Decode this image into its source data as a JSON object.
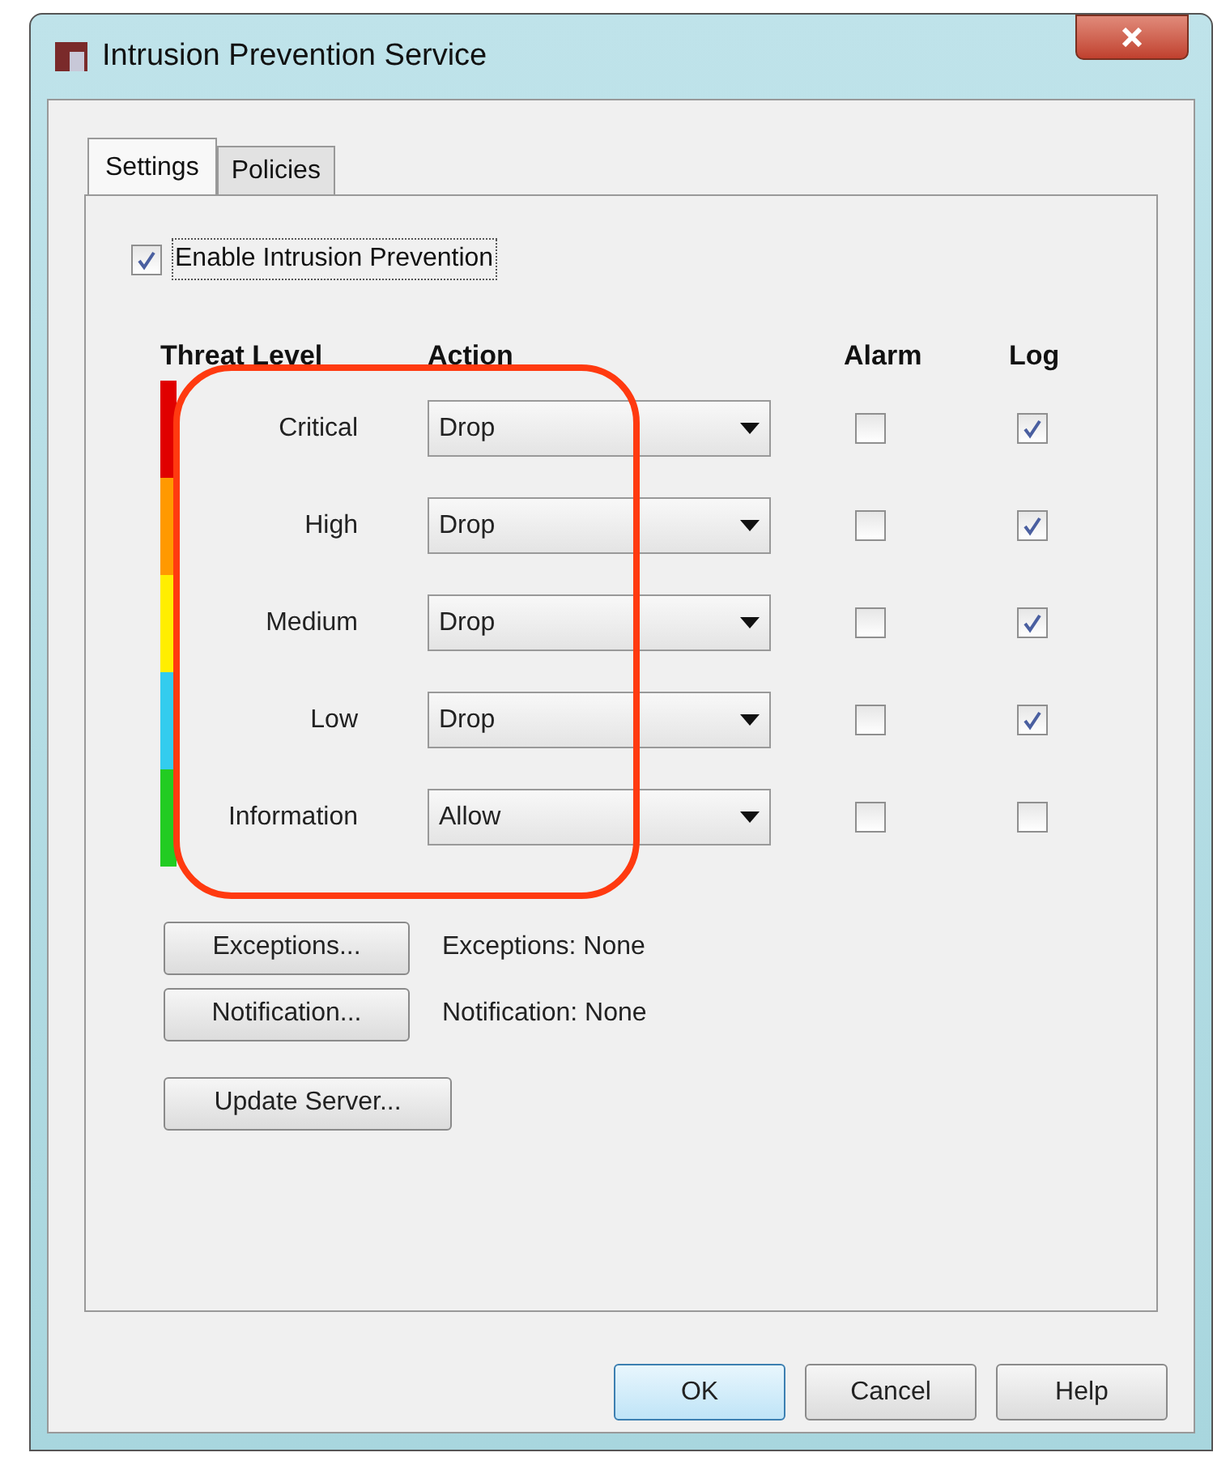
{
  "window": {
    "title": "Intrusion Prevention Service"
  },
  "tabs": [
    {
      "label": "Settings",
      "selected": true
    },
    {
      "label": "Policies",
      "selected": false
    }
  ],
  "enable": {
    "label": "Enable Intrusion Prevention",
    "checked": true
  },
  "columns": [
    "Threat Level",
    "Action",
    "Alarm",
    "Log"
  ],
  "rows": [
    {
      "level": "Critical",
      "color": "#e00000",
      "action": "Drop",
      "alarm": false,
      "log": true
    },
    {
      "level": "High",
      "color": "#ff9900",
      "action": "Drop",
      "alarm": false,
      "log": true
    },
    {
      "level": "Medium",
      "color": "#ffee00",
      "action": "Drop",
      "alarm": false,
      "log": true
    },
    {
      "level": "Low",
      "color": "#33ccee",
      "action": "Drop",
      "alarm": false,
      "log": true
    },
    {
      "level": "Information",
      "color": "#22cc22",
      "action": "Allow",
      "alarm": false,
      "log": false
    }
  ],
  "options": [
    {
      "button": "Exceptions...",
      "status": "Exceptions: None"
    },
    {
      "button": "Notification...",
      "status": "Notification: None"
    }
  ],
  "update_button": "Update Server...",
  "footer_buttons": [
    "OK",
    "Cancel",
    "Help"
  ]
}
